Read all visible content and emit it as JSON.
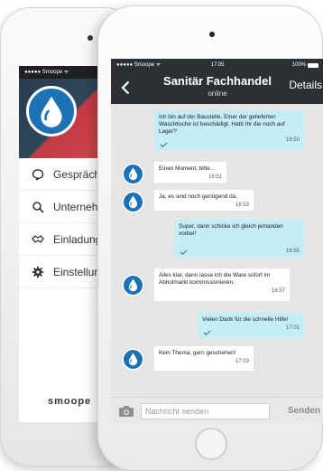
{
  "back_app": {
    "status_carrier": "●●●●● Smoope ᯤ",
    "menu": [
      {
        "label": "Gespräche",
        "icon": "chat-icon"
      },
      {
        "label": "Unternehmen",
        "icon": "search-icon"
      },
      {
        "label": "Einladungen",
        "icon": "handshake-icon"
      },
      {
        "label": "Einstellungen",
        "icon": "gear-icon"
      }
    ],
    "logo": "smoope",
    "header_colors": [
      "#2a3c4d",
      "#c23a44"
    ]
  },
  "status_bar": {
    "carrier": "●●●●● Smoope ᯤ",
    "time": "17:05",
    "battery": "100%"
  },
  "nav": {
    "title": "Sanitär Fachhandel",
    "subtitle": "online",
    "action": "Details",
    "back_icon": "chevron-left-icon"
  },
  "messages": [
    {
      "direction": "out",
      "text": "Ich bin auf der Baustelle. Einer der gelieferten Waschtische ist beschädigt. Habt Ihr die noch auf Lager?",
      "time": "16:50",
      "read": true
    },
    {
      "direction": "in",
      "text": "Einen Moment, bitte...",
      "time": "16:51"
    },
    {
      "direction": "in",
      "text": "Ja, es sind noch genügend da.",
      "time": "16:53"
    },
    {
      "direction": "out",
      "text": "Super, dann schicke ich gleich jemanden vorbei!",
      "time": "16:55",
      "read": true
    },
    {
      "direction": "in",
      "text": "Alles klar, dann lasse ich die Ware sofort im Abholmarkt kommissionieren.",
      "time": "16:57"
    },
    {
      "direction": "out",
      "text": "Vielen Dank für die schnelle Hilfe!",
      "time": "17:01",
      "read": true
    },
    {
      "direction": "in",
      "text": "Kein Thema, gern geschehen!",
      "time": "17:03"
    }
  ],
  "input": {
    "placeholder": "Nachricht senden",
    "send_label": "Senden",
    "camera_icon": "camera-icon"
  },
  "colors": {
    "nav_bar": "#2c3034",
    "outgoing_bubble": "#c3eef6",
    "incoming_bubble": "#ffffff",
    "chat_background": "#e6e6e6",
    "avatar": "#1c72b4"
  }
}
